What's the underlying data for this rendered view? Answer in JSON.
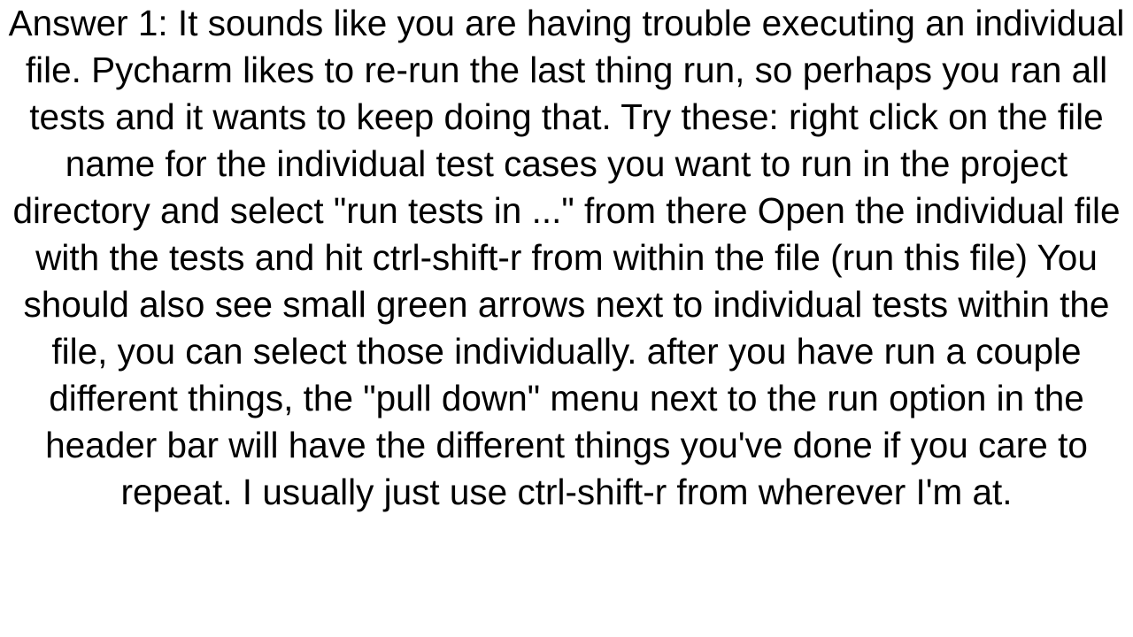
{
  "answer": {
    "text": "Answer 1: It sounds like you are having trouble executing an individual file.  Pycharm likes to re-run the last thing run, so perhaps you ran all tests and it wants to keep doing that.  Try these:  right click on the file name for the individual test cases you want to run in the project directory and select \"run tests in ...\" from there  Open the individual file with the tests and hit ctrl-shift-r from within the file (run this file)  You should also see small green arrows next to individual tests within the file, you can select those individually.   after you have run a couple different things, the \"pull down\" menu next to the run option in the header bar will have the different things you've done if you care to repeat.  I usually just use ctrl-shift-r from wherever I'm at."
  }
}
